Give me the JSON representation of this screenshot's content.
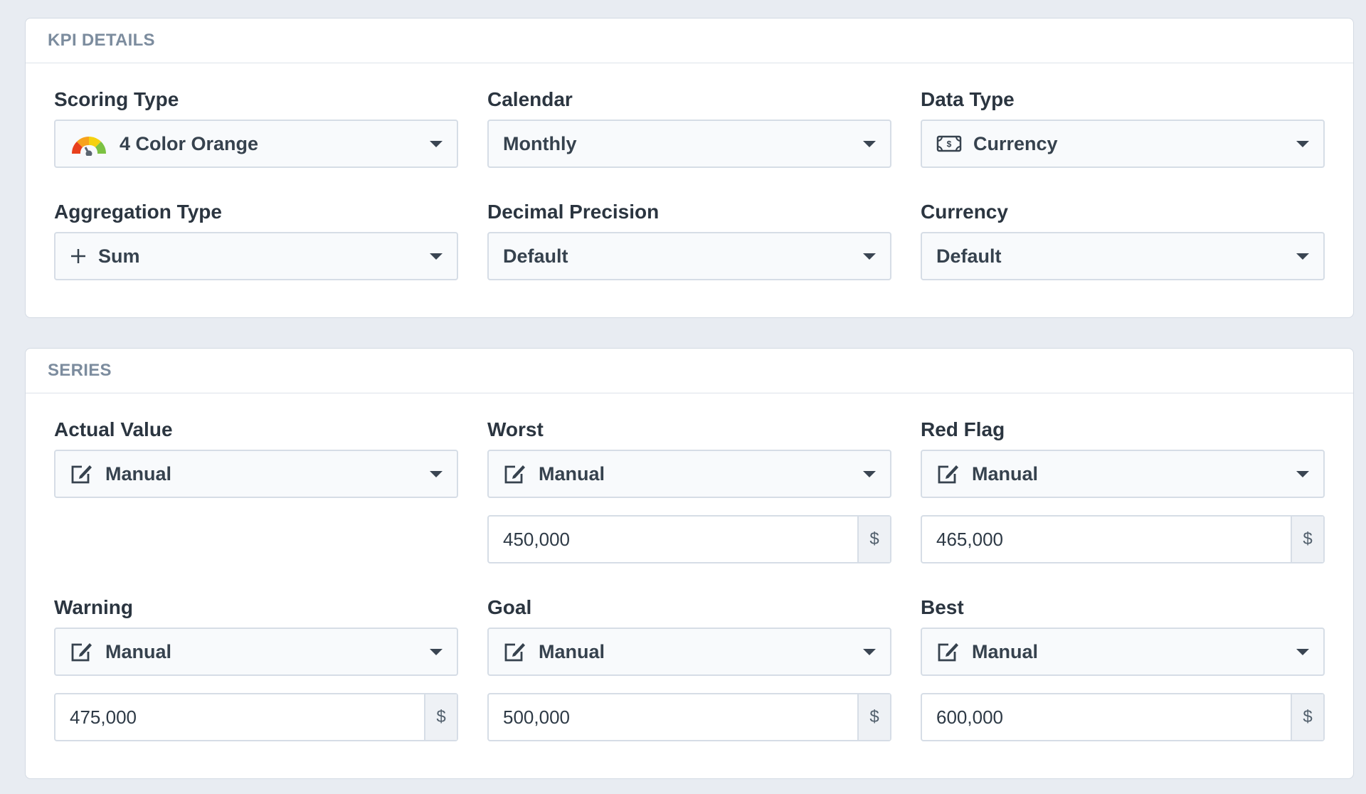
{
  "kpi_details": {
    "title": "KPI DETAILS",
    "scoring_type": {
      "label": "Scoring Type",
      "value": "4 Color Orange",
      "icon": "gauge-icon"
    },
    "calendar": {
      "label": "Calendar",
      "value": "Monthly"
    },
    "data_type": {
      "label": "Data Type",
      "value": "Currency",
      "icon": "money-icon"
    },
    "aggregation_type": {
      "label": "Aggregation Type",
      "value": "Sum",
      "icon": "plus-icon"
    },
    "decimal_precision": {
      "label": "Decimal Precision",
      "value": "Default"
    },
    "currency": {
      "label": "Currency",
      "value": "Default"
    }
  },
  "series": {
    "title": "SERIES",
    "actual_value": {
      "label": "Actual Value",
      "source": "Manual",
      "icon": "edit-icon"
    },
    "worst": {
      "label": "Worst",
      "source": "Manual",
      "icon": "edit-icon",
      "amount": "450,000",
      "unit": "$"
    },
    "red_flag": {
      "label": "Red Flag",
      "source": "Manual",
      "icon": "edit-icon",
      "amount": "465,000",
      "unit": "$"
    },
    "warning": {
      "label": "Warning",
      "source": "Manual",
      "icon": "edit-icon",
      "amount": "475,000",
      "unit": "$"
    },
    "goal": {
      "label": "Goal",
      "source": "Manual",
      "icon": "edit-icon",
      "amount": "500,000",
      "unit": "$"
    },
    "best": {
      "label": "Best",
      "source": "Manual",
      "icon": "edit-icon",
      "amount": "600,000",
      "unit": "$"
    }
  },
  "colors": {
    "page_background": "#e8ecf2",
    "panel_border": "#d3dae3",
    "section_title": "#7c8c9e",
    "gauge": [
      "#e8401c",
      "#f7a21b",
      "#f5d10f",
      "#7cc242"
    ]
  }
}
